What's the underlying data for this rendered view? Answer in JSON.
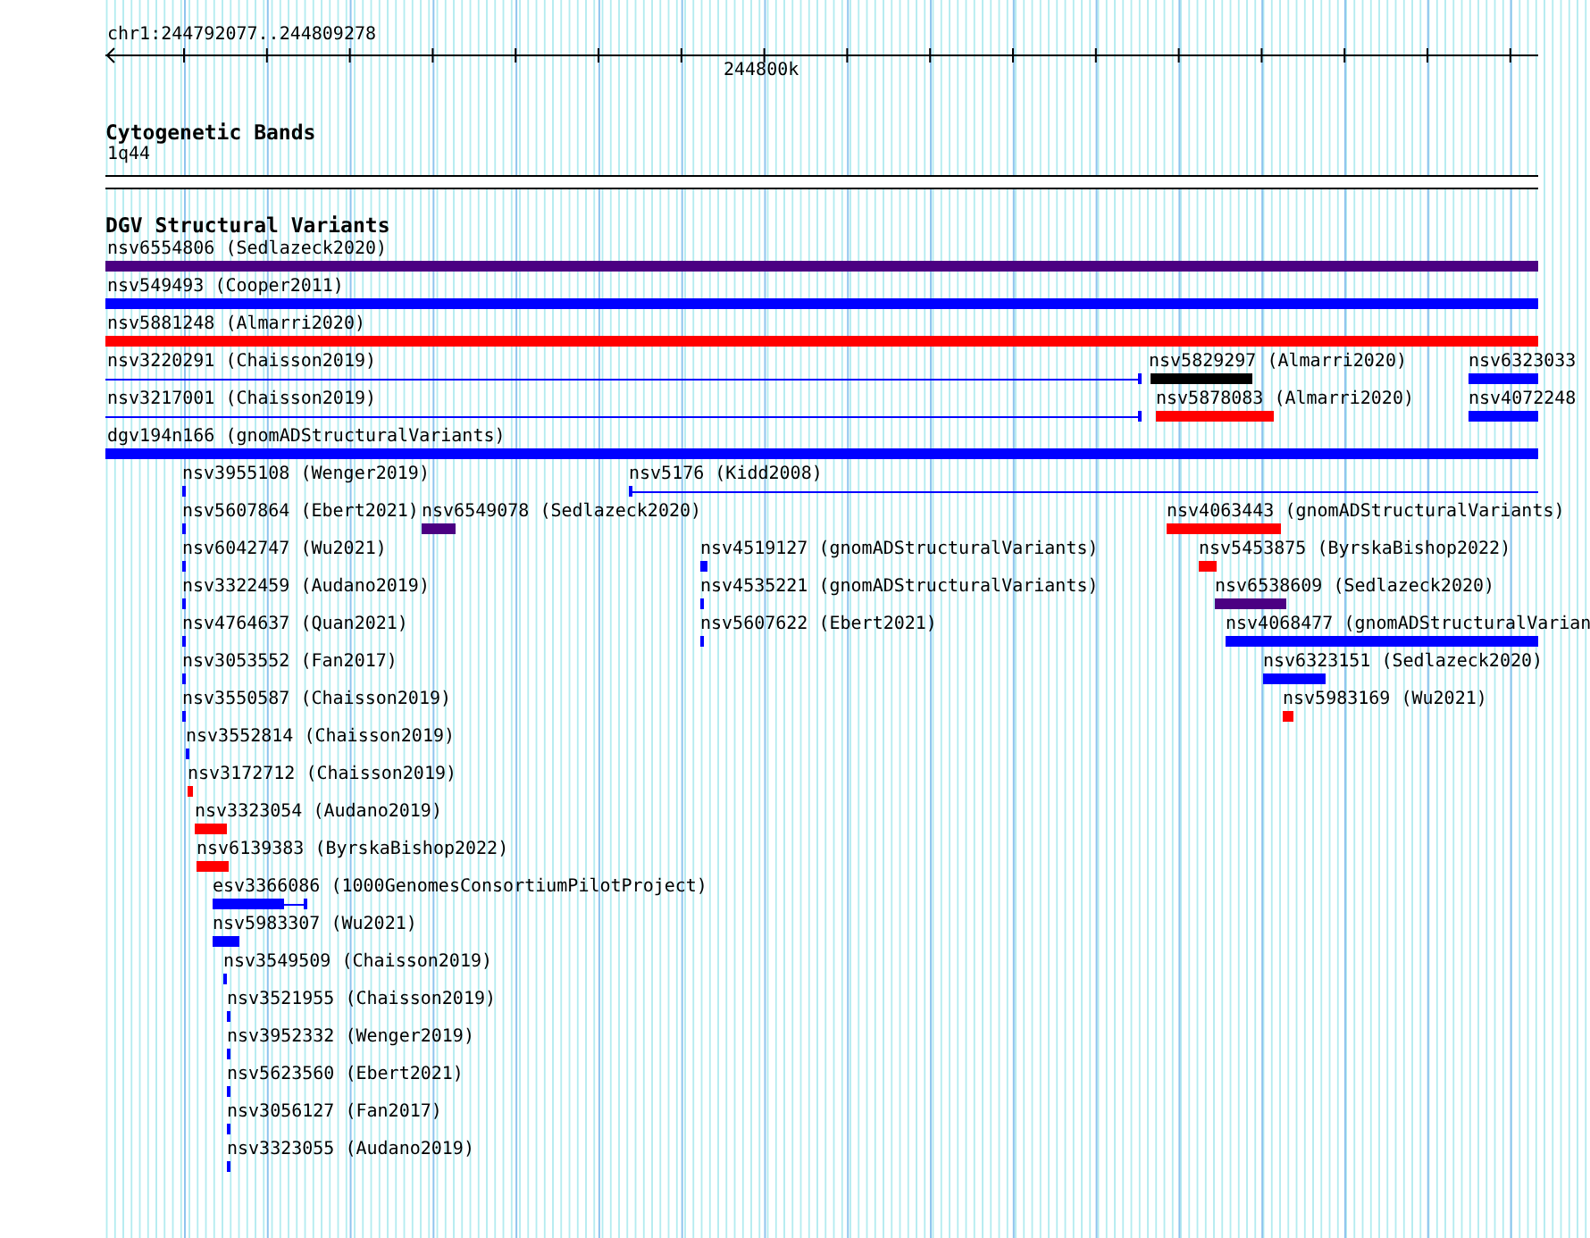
{
  "ruler": {
    "location": "chr1:244792077..244809278",
    "tick_label": "244800k"
  },
  "cytoband_track": {
    "title": "Cytogenetic Bands",
    "band": "1q44"
  },
  "variant_track": {
    "title": "DGV Structural Variants",
    "rows": [
      {
        "features": [
          {
            "label": "nsv6554806 (Sedlazeck2020)",
            "kind": "bar",
            "color": "#4b0082"
          }
        ]
      },
      {
        "features": [
          {
            "label": "nsv549493 (Cooper2011)",
            "kind": "bar",
            "color": "#0000ff"
          }
        ]
      },
      {
        "features": [
          {
            "label": "nsv5881248 (Almarri2020)",
            "kind": "bar",
            "color": "#ff0000"
          }
        ]
      },
      {
        "features": [
          {
            "label": "nsv3220291 (Chaisson2019)",
            "kind": "line",
            "color": "#0000ff"
          },
          {
            "label": "nsv5829297 (Almarri2020)",
            "kind": "bar",
            "color": "#000000"
          },
          {
            "label": "nsv6323033",
            "kind": "bar",
            "color": "#0000ff"
          }
        ]
      },
      {
        "features": [
          {
            "label": "nsv3217001 (Chaisson2019)",
            "kind": "line",
            "color": "#0000ff"
          },
          {
            "label": "nsv5878083 (Almarri2020)",
            "kind": "bar",
            "color": "#ff0000"
          },
          {
            "label": "nsv4072248",
            "kind": "bar",
            "color": "#0000ff"
          }
        ]
      },
      {
        "features": [
          {
            "label": "dgv194n166 (gnomADStructuralVariants)",
            "kind": "bar",
            "color": "#0000ff"
          }
        ]
      },
      {
        "features": [
          {
            "label": "nsv3955108 (Wenger2019)",
            "kind": "bar",
            "color": "#0000ff"
          },
          {
            "label": "nsv5176 (Kidd2008)",
            "kind": "line",
            "color": "#0000ff"
          }
        ]
      },
      {
        "features": [
          {
            "label": "nsv5607864 (Ebert2021)",
            "kind": "bar",
            "color": "#0000ff"
          },
          {
            "label": "nsv6549078 (Sedlazeck2020)",
            "kind": "bar",
            "color": "#4b0082"
          },
          {
            "label": "nsv4063443 (gnomADStructuralVariants)",
            "kind": "bar",
            "color": "#ff0000"
          }
        ]
      },
      {
        "features": [
          {
            "label": "nsv6042747 (Wu2021)",
            "kind": "bar",
            "color": "#0000ff"
          },
          {
            "label": "nsv4519127 (gnomADStructuralVariants)",
            "kind": "bar",
            "color": "#0000ff"
          },
          {
            "label": "nsv5453875 (ByrskaBishop2022)",
            "kind": "bar",
            "color": "#ff0000"
          }
        ]
      },
      {
        "features": [
          {
            "label": "nsv3322459 (Audano2019)",
            "kind": "bar",
            "color": "#0000ff"
          },
          {
            "label": "nsv4535221 (gnomADStructuralVariants)",
            "kind": "bar",
            "color": "#0000ff"
          },
          {
            "label": "nsv6538609 (Sedlazeck2020)",
            "kind": "bar",
            "color": "#4b0082"
          }
        ]
      },
      {
        "features": [
          {
            "label": "nsv4764637 (Quan2021)",
            "kind": "bar",
            "color": "#0000ff"
          },
          {
            "label": "nsv5607622 (Ebert2021)",
            "kind": "bar",
            "color": "#0000ff"
          },
          {
            "label": "nsv4068477 (gnomADStructuralVarian",
            "kind": "bar",
            "color": "#0000ff"
          }
        ]
      },
      {
        "features": [
          {
            "label": "nsv3053552 (Fan2017)",
            "kind": "bar",
            "color": "#0000ff"
          },
          {
            "label": "nsv6323151 (Sedlazeck2020)",
            "kind": "bar",
            "color": "#0000ff"
          }
        ]
      },
      {
        "features": [
          {
            "label": "nsv3550587 (Chaisson2019)",
            "kind": "bar",
            "color": "#0000ff"
          },
          {
            "label": "nsv5983169 (Wu2021)",
            "kind": "bar",
            "color": "#ff0000"
          }
        ]
      },
      {
        "features": [
          {
            "label": "nsv3552814 (Chaisson2019)",
            "kind": "bar",
            "color": "#0000ff"
          }
        ]
      },
      {
        "features": [
          {
            "label": "nsv3172712 (Chaisson2019)",
            "kind": "bar",
            "color": "#ff0000"
          }
        ]
      },
      {
        "features": [
          {
            "label": "nsv3323054 (Audano2019)",
            "kind": "bar",
            "color": "#ff0000"
          }
        ]
      },
      {
        "features": [
          {
            "label": "nsv6139383 (ByrskaBishop2022)",
            "kind": "bar",
            "color": "#ff0000"
          }
        ]
      },
      {
        "features": [
          {
            "label": "esv3366086 (1000GenomesConsortiumPilotProject)",
            "kind": "bar_line",
            "color": "#0000ff"
          }
        ]
      },
      {
        "features": [
          {
            "label": "nsv5983307 (Wu2021)",
            "kind": "bar",
            "color": "#0000ff"
          }
        ]
      },
      {
        "features": [
          {
            "label": "nsv3549509 (Chaisson2019)",
            "kind": "bar",
            "color": "#0000ff"
          }
        ]
      },
      {
        "features": [
          {
            "label": "nsv3521955 (Chaisson2019)",
            "kind": "bar",
            "color": "#0000ff"
          }
        ]
      },
      {
        "features": [
          {
            "label": "nsv3952332 (Wenger2019)",
            "kind": "bar",
            "color": "#0000ff"
          }
        ]
      },
      {
        "features": [
          {
            "label": "nsv5623560 (Ebert2021)",
            "kind": "bar",
            "color": "#0000ff"
          }
        ]
      },
      {
        "features": [
          {
            "label": "nsv3056127 (Fan2017)",
            "kind": "bar",
            "color": "#0000ff"
          }
        ]
      },
      {
        "features": [
          {
            "label": "nsv3323055 (Audano2019)",
            "kind": "bar",
            "color": "#0000ff"
          }
        ]
      }
    ]
  }
}
